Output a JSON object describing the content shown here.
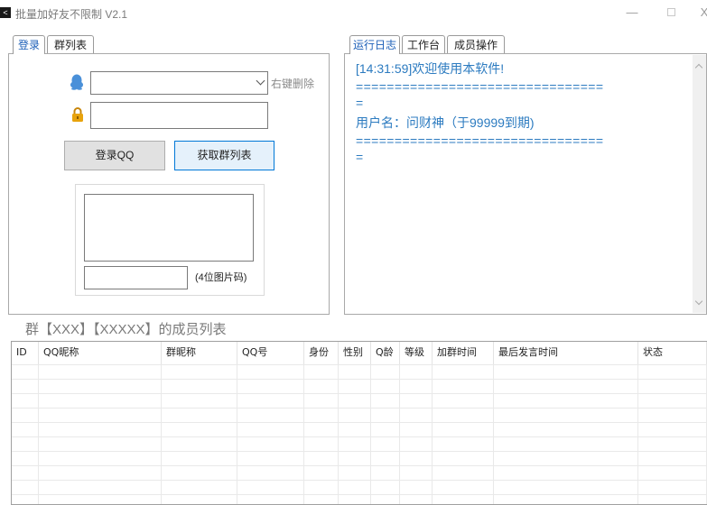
{
  "window": {
    "title": "批量加好友不限制 V2.1",
    "app_icon": "<",
    "minimize_label": "—",
    "close_label": "X"
  },
  "left_tabs": [
    {
      "label": "登录",
      "active": true
    },
    {
      "label": "群列表",
      "active": false
    }
  ],
  "right_tabs": [
    {
      "label": "运行日志",
      "active": true
    },
    {
      "label": "工作台",
      "active": false
    },
    {
      "label": "成员操作",
      "active": false
    }
  ],
  "login": {
    "account_value": "",
    "right_click_delete": "右键删除",
    "password_value": "",
    "login_button": "登录QQ",
    "get_groups_button": "获取群列表",
    "captcha_value": "",
    "captcha_hint": "(4位图片码)"
  },
  "log": {
    "lines": [
      "[14:31:59]欢迎使用本软件!",
      "================================",
      "=",
      "用户名：问财神（于99999到期)",
      "================================",
      "="
    ]
  },
  "member_list": {
    "title": "群【XXX】【XXXXX】的成员列表",
    "columns": [
      "ID",
      "QQ昵称",
      "群昵称",
      "QQ号",
      "身份",
      "性别",
      "Q龄",
      "等级",
      "加群时间",
      "最后发言时间",
      "状态"
    ],
    "rows": []
  },
  "colors": {
    "accent_blue": "#2c7bc0",
    "button_border_blue": "#0078d7",
    "qq_icon": "#4a90d9",
    "lock_icon": "#e8a30c"
  },
  "icons": {
    "qq": "qq-penguin-icon",
    "lock": "lock-icon"
  }
}
